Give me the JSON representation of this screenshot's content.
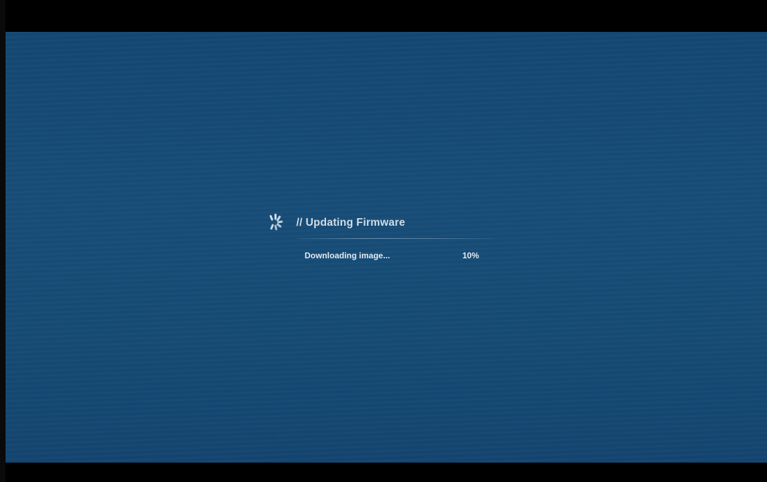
{
  "dialog": {
    "title": "// Updating Firmware",
    "status": "Downloading image...",
    "progress_text": "10%",
    "progress": 0.1
  },
  "icons": {
    "spinner": "loading-spinner-icon"
  },
  "colors": {
    "screen_background": "#164b74",
    "letterbox": "#000000",
    "text": "#e4ebf2"
  }
}
